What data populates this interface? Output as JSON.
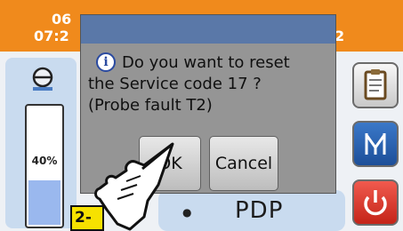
{
  "status": {
    "date": "06",
    "time": "07:2",
    "top_right_fragment": "2"
  },
  "gauge": {
    "percent_label": "40%",
    "level_fraction": 0.4
  },
  "main": {
    "pdp_label": "PDP",
    "drop_icon": "water-drop-icon"
  },
  "side_buttons": [
    {
      "name": "report",
      "icon": "clipboard-icon"
    },
    {
      "name": "service",
      "icon": "service-valve-icon"
    },
    {
      "name": "power",
      "icon": "power-icon"
    }
  ],
  "dialog": {
    "info_icon": "i",
    "line1": "Do you want to reset",
    "line2": "the Service code 17 ?",
    "line3": "(Probe fault T2)",
    "ok_label": "OK",
    "cancel_label": "Cancel"
  },
  "annotation": {
    "step_label": "2-",
    "pointer": "pointing-hand-icon"
  },
  "colors": {
    "header": "#f08a1c",
    "panel": "#c9dbef",
    "dialog_bg": "#959595",
    "title_bar": "#5a78a8",
    "badge": "#f6e100"
  }
}
